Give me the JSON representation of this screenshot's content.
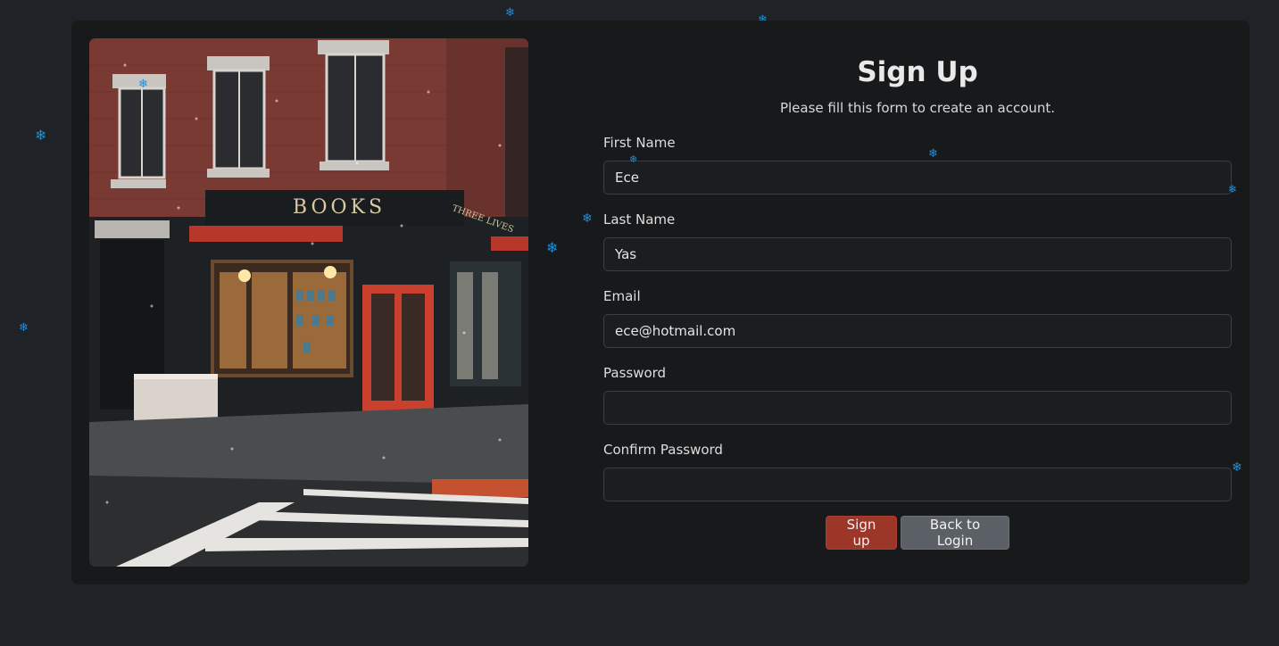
{
  "form": {
    "title": "Sign Up",
    "subtitle": "Please fill this form to create an account.",
    "fields": {
      "first_name": {
        "label": "First Name",
        "value": "Ece"
      },
      "last_name": {
        "label": "Last Name",
        "value": "Yas"
      },
      "email": {
        "label": "Email",
        "value": "ece@hotmail.com"
      },
      "password": {
        "label": "Password",
        "value": ""
      },
      "confirm_password": {
        "label": "Confirm Password",
        "value": ""
      }
    },
    "buttons": {
      "signup": "Sign up",
      "back_to_login": "Back to Login"
    }
  },
  "photo": {
    "sign_text": "BOOKS",
    "side_sign_text": "THREE LIVES"
  },
  "colors": {
    "background": "#1f2226",
    "card": "#18191b",
    "primary_button": "#9c3628",
    "secondary_button": "#5a6065",
    "snowflake": "#1f8fd6"
  },
  "icons": {
    "snowflake": "❄"
  }
}
